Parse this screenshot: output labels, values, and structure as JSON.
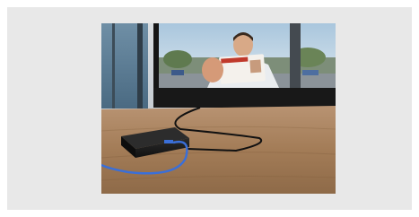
{
  "image": {
    "kind": "photo",
    "subject": "hdmi-device-on-desk-with-tv-showing-man-holding-id-card"
  },
  "colors": {
    "background": "#e8e8e8",
    "desk": "#a07a55",
    "tv_bezel": "#1a1a1a",
    "cable": "#3a6fd8",
    "device": "#1e1e1e"
  }
}
